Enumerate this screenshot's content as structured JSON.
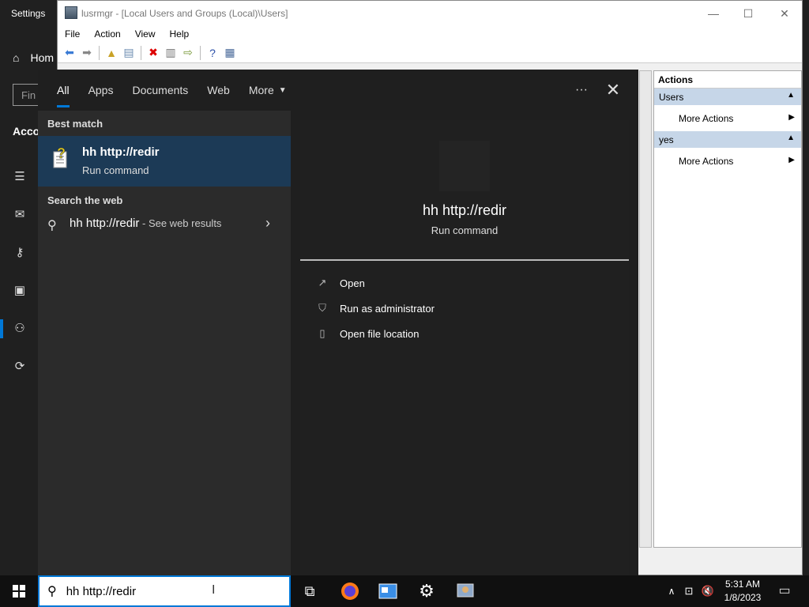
{
  "settings": {
    "title": "Settings",
    "home_label": "Hom",
    "find_placeholder": "Fin",
    "section": "Acco"
  },
  "lusrmgr": {
    "title": "lusrmgr - [Local Users and Groups (Local)\\Users]",
    "menu": [
      "File",
      "Action",
      "View",
      "Help"
    ],
    "actions_header": "Actions",
    "groups": [
      {
        "label": "Users",
        "item": "More Actions"
      },
      {
        "label": "yes",
        "item": "More Actions"
      }
    ]
  },
  "search": {
    "tabs": [
      "All",
      "Apps",
      "Documents",
      "Web",
      "More"
    ],
    "best_match_header": "Best match",
    "best_match": {
      "name": "hh http://redir",
      "type": "Run command"
    },
    "web_header": "Search the web",
    "web_query": "hh http://redir",
    "web_suffix": " - See web results",
    "preview": {
      "title": "hh http://redir",
      "subtitle": "Run command"
    },
    "actions": [
      "Open",
      "Run as administrator",
      "Open file location"
    ]
  },
  "taskbar": {
    "search_value": "hh http://redir",
    "time": "5:31 AM",
    "date": "1/8/2023"
  },
  "colors": {
    "accent": "#0078d7",
    "selected_bg": "#1c3a56",
    "actions_group": "#c6d6e8"
  }
}
